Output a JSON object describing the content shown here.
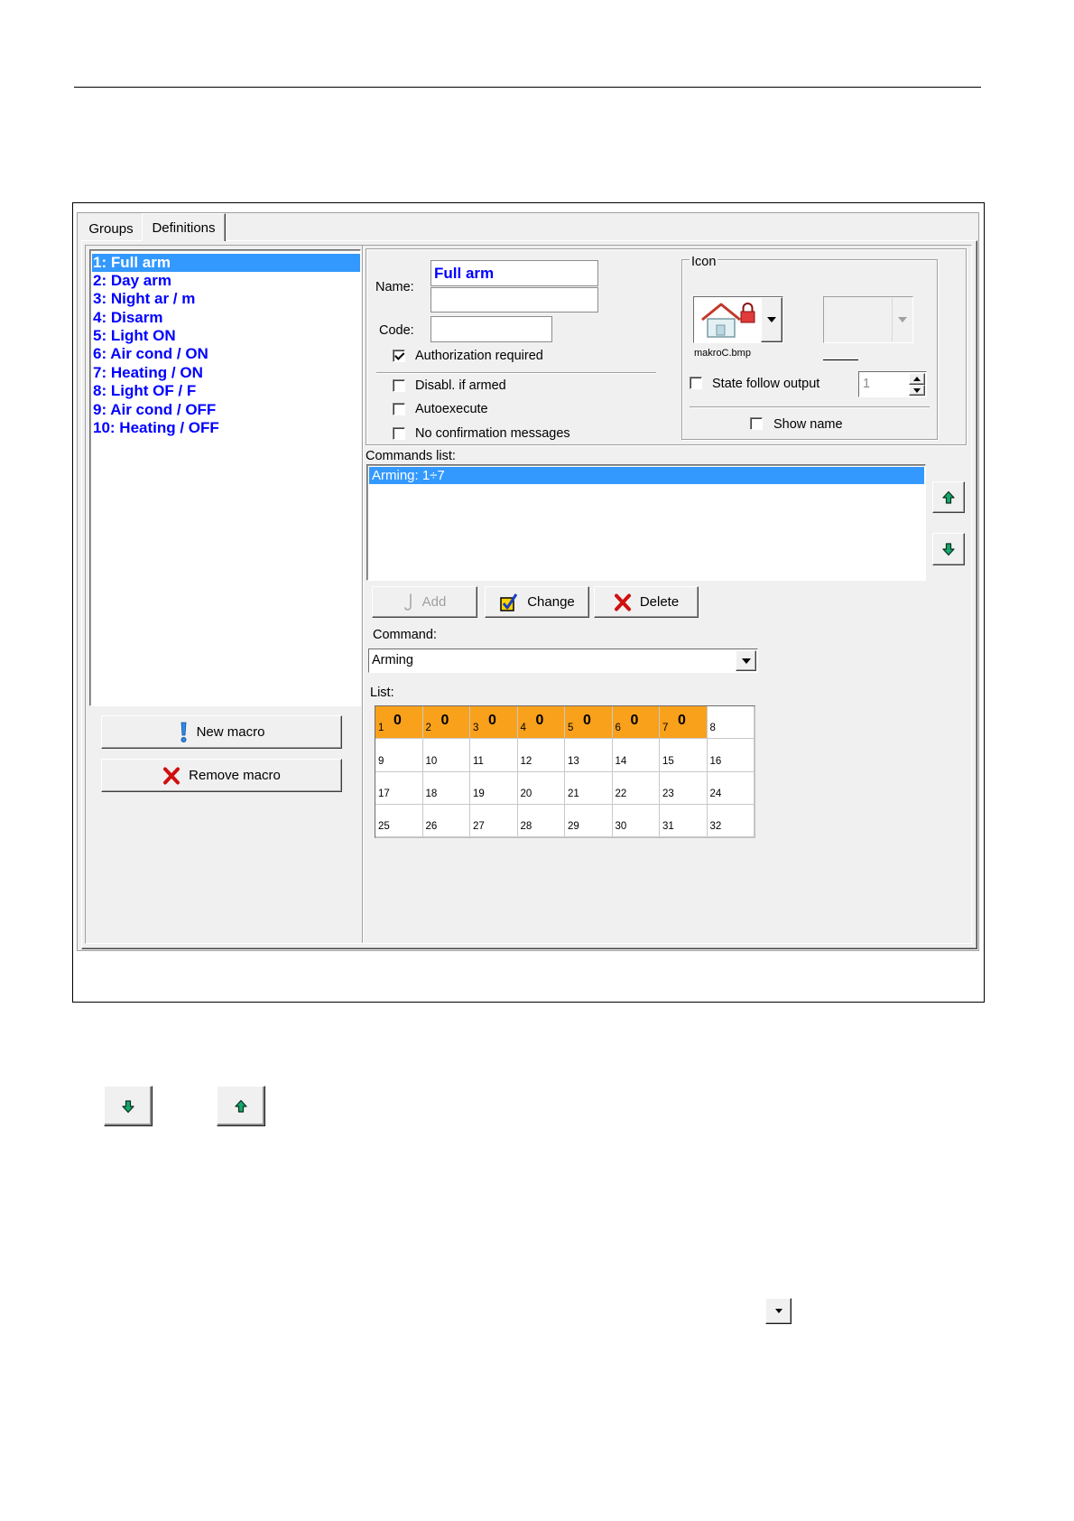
{
  "colors": {
    "dialog_bg": "#f0f0f0",
    "selection": "#3399ff",
    "macro_text": "#0000ff",
    "active_cell": "#f9a11b"
  },
  "tabs": [
    {
      "label": "Groups"
    },
    {
      "label": "Definitions"
    }
  ],
  "active_tab": 1,
  "macros": {
    "items": [
      "1: Full arm",
      "2: Day arm",
      "3: Night ar / m",
      "4: Disarm",
      "5: Light ON",
      "6: Air cond / ON",
      "7: Heating / ON",
      "8: Light OF / F",
      "9: Air cond / OFF",
      "10: Heating / OFF"
    ],
    "selected_index": 0,
    "new_button": {
      "label": "New macro",
      "icon": "exclamation-icon"
    },
    "remove_button": {
      "label": "Remove macro",
      "icon": "delete-x-icon"
    }
  },
  "form": {
    "name_label": "Name:",
    "name_value": "Full arm",
    "name_value_2": "",
    "code_label": "Code:",
    "code_value": "",
    "authorization": {
      "label": "Authorization required",
      "checked": true
    },
    "disabl_if_armed": {
      "label": "Disabl. if armed",
      "checked": false
    },
    "autoexecute": {
      "label": "Autoexecute",
      "checked": false
    },
    "no_confirmation": {
      "label": "No confirmation messages",
      "checked": false
    }
  },
  "icon_group": {
    "title": "Icon",
    "icon": "house-lock-icon",
    "icon_file": "makroC.bmp",
    "state_follow_output": {
      "label": "State follow output",
      "checked": false
    },
    "state_value": "1",
    "show_name": {
      "label": "Show name",
      "checked": false
    }
  },
  "commands": {
    "label": "Commands list:",
    "items": [
      "Arming: 1÷7"
    ],
    "selected_index": 0,
    "add": {
      "label": "Add",
      "enabled": false
    },
    "change": {
      "label": "Change",
      "icon": "check-box-icon"
    },
    "delete": {
      "label": "Delete",
      "icon": "delete-x-icon"
    },
    "move_up_icon": "arrow-up-icon",
    "move_down_icon": "arrow-down-icon"
  },
  "command": {
    "label": "Command:",
    "value": "Arming"
  },
  "list": {
    "label": "List:",
    "cells": [
      {
        "n": 1,
        "active": true,
        "value": "0"
      },
      {
        "n": 2,
        "active": true,
        "value": "0"
      },
      {
        "n": 3,
        "active": true,
        "value": "0"
      },
      {
        "n": 4,
        "active": true,
        "value": "0"
      },
      {
        "n": 5,
        "active": true,
        "value": "0"
      },
      {
        "n": 6,
        "active": true,
        "value": "0"
      },
      {
        "n": 7,
        "active": true,
        "value": "0"
      },
      {
        "n": 8,
        "active": false
      },
      {
        "n": 9,
        "active": false
      },
      {
        "n": 10,
        "active": false
      },
      {
        "n": 11,
        "active": false
      },
      {
        "n": 12,
        "active": false
      },
      {
        "n": 13,
        "active": false
      },
      {
        "n": 14,
        "active": false
      },
      {
        "n": 15,
        "active": false
      },
      {
        "n": 16,
        "active": false
      },
      {
        "n": 17,
        "active": false
      },
      {
        "n": 18,
        "active": false
      },
      {
        "n": 19,
        "active": false
      },
      {
        "n": 20,
        "active": false
      },
      {
        "n": 21,
        "active": false
      },
      {
        "n": 22,
        "active": false
      },
      {
        "n": 23,
        "active": false
      },
      {
        "n": 24,
        "active": false
      },
      {
        "n": 25,
        "active": false
      },
      {
        "n": 26,
        "active": false
      },
      {
        "n": 27,
        "active": false
      },
      {
        "n": 28,
        "active": false
      },
      {
        "n": 29,
        "active": false
      },
      {
        "n": 30,
        "active": false
      },
      {
        "n": 31,
        "active": false
      },
      {
        "n": 32,
        "active": false
      }
    ]
  },
  "doc_buttons": {
    "down_icon": "arrow-down-icon",
    "up_icon": "arrow-up-icon",
    "dropdown_icon": "chevron-down-icon"
  }
}
